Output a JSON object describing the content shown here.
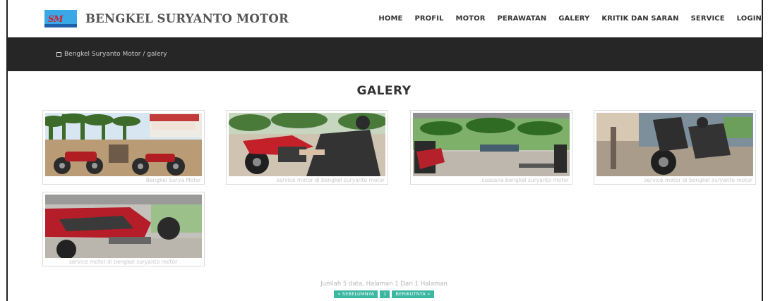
{
  "brand": {
    "title": "BENGKEL SURYANTO MOTOR",
    "logo_icon": "logo-icon",
    "logo_text": "SM"
  },
  "nav": {
    "items": [
      "HOME",
      "PROFIL",
      "MOTOR",
      "PERAWATAN",
      "GALERY",
      "KRITIK DAN SARAN",
      "SERVICE",
      "LOGIN"
    ]
  },
  "breadcrumb": {
    "icon": "home-icon",
    "text": "Bengkel Suryanto Motor / galery"
  },
  "page": {
    "title": "GALERY"
  },
  "gallery": [
    {
      "caption": "Bengkel Surya Motor"
    },
    {
      "caption": "service motor di bengkel suryanto motor"
    },
    {
      "caption": "suasana bengkel suryanto motor"
    },
    {
      "caption": "service motor di bengkel suryanto motor"
    },
    {
      "caption": "service motor di bengkel suryanto motor"
    }
  ],
  "pagination": {
    "info": "Jumlah 5 data, Halaman 1 Dari 1 Halaman",
    "prev": "« SEBELUMNYA",
    "current": "1",
    "next": "BERIKUTNYA »"
  },
  "colors": {
    "banner": "#262626",
    "pager": "#3bb7a2",
    "logo_bg": "#3aa7e6"
  }
}
